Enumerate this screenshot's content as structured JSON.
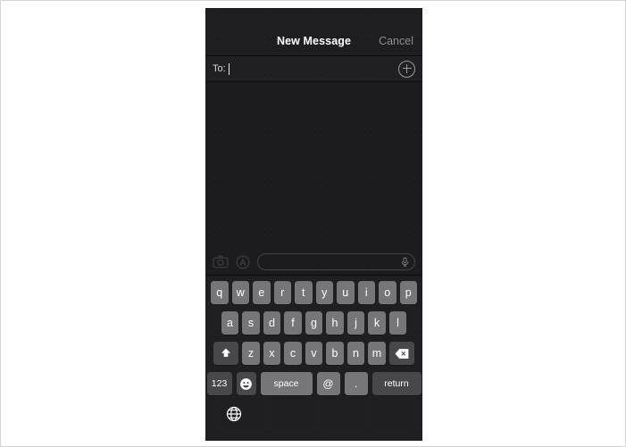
{
  "app": {
    "screen_background": "#1c1c1e",
    "page_background": "#ffffff"
  },
  "navbar": {
    "title": "New Message",
    "cancel_label": "Cancel",
    "title_color": "#ffffff",
    "cancel_color": "#8e8e93"
  },
  "recipient_field": {
    "label": "To:",
    "value": "",
    "add_button_icon": "plus-circle-icon"
  },
  "input_bar": {
    "camera_icon": "camera-icon",
    "apps_icon": "app-store-icon",
    "message_placeholder": "",
    "message_value": "",
    "mic_icon": "microphone-icon"
  },
  "keyboard": {
    "key_color": "#75757a",
    "special_key_color": "#48484c",
    "background": "#1f1f21",
    "rows": [
      {
        "name": "row-1",
        "keys": [
          "q",
          "w",
          "e",
          "r",
          "t",
          "y",
          "u",
          "i",
          "o",
          "p"
        ]
      },
      {
        "name": "row-2",
        "keys": [
          "a",
          "s",
          "d",
          "f",
          "g",
          "h",
          "j",
          "k",
          "l"
        ]
      },
      {
        "name": "row-3",
        "shift_label": "shift-icon",
        "keys": [
          "z",
          "x",
          "c",
          "v",
          "b",
          "n",
          "m"
        ],
        "delete_label": "delete-icon"
      },
      {
        "name": "row-4",
        "numeric_label": "123",
        "emoji_label": "☺",
        "space_label": "space",
        "at_label": "@",
        "period_label": ".",
        "return_label": "return"
      }
    ],
    "globe_icon": "globe-icon"
  }
}
